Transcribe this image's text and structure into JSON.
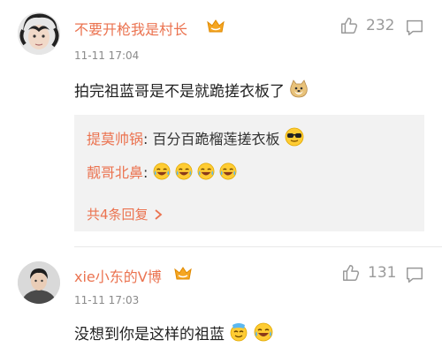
{
  "comments": [
    {
      "username": "不要开枪我是村长",
      "time": "11-11 17:04",
      "text": "拍完祖蓝哥是不是就跪搓衣板了",
      "likes": "232",
      "icons": {
        "badge": "vip-crown-badge-icon",
        "text_emoji": "doge-emoji-icon",
        "like": "thumbs-up-icon",
        "comment": "comment-bubble-icon"
      },
      "replies": [
        {
          "author": "提莫帅锅",
          "sep": ": ",
          "content": "百分百跪榴莲搓衣板",
          "emoji": "cool-sunglasses-emoji-icon"
        },
        {
          "author": "靓哥北鼻",
          "sep": ": ",
          "content": "",
          "emoji": "laugh-tears-emoji-icon x4"
        }
      ],
      "more_replies": "共4条回复"
    },
    {
      "username": "xie小东的V博",
      "time": "11-11 17:03",
      "text": "没想到你是这样的祖蓝",
      "likes": "131",
      "icons": {
        "badge": "vip-crown-badge-icon",
        "text_emoji": "sweat-emoji-icon, laugh-tears-emoji-icon",
        "like": "thumbs-up-icon",
        "comment": "comment-bubble-icon"
      }
    }
  ],
  "colors": {
    "username": "#eb7350",
    "muted": "#8a8a8a",
    "reply_bg": "#f2f2f2",
    "badge": "#f5a623"
  }
}
